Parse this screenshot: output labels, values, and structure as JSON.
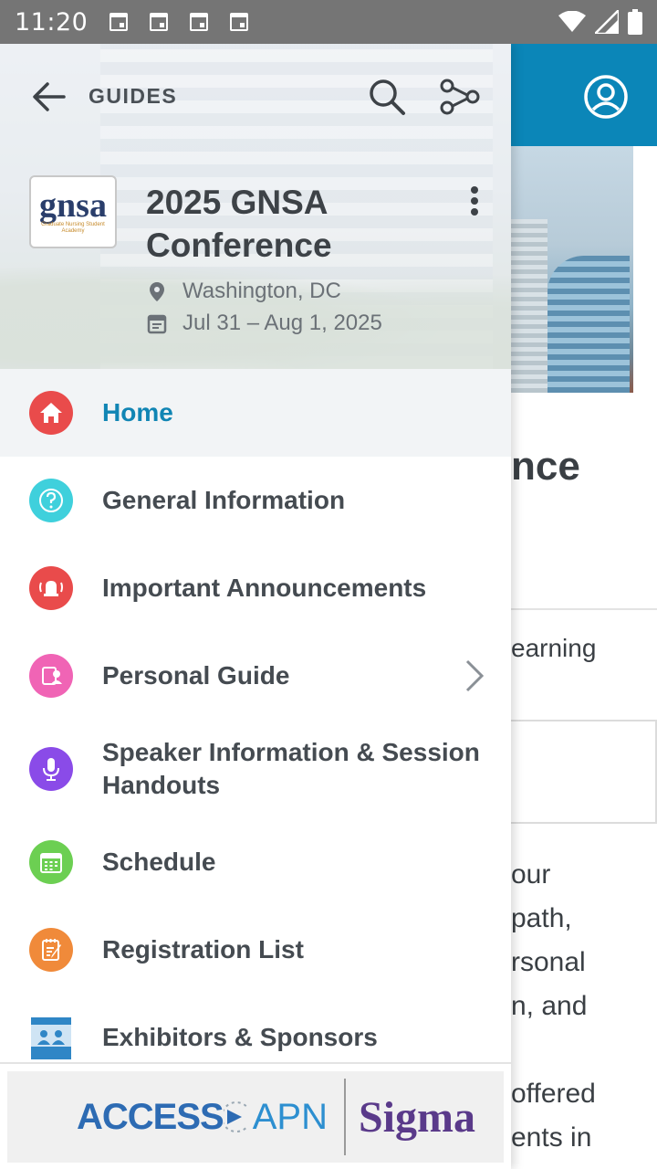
{
  "status_bar": {
    "time": "11:20"
  },
  "drawer": {
    "header": {
      "back_label": "GUIDES",
      "logo_text": "gnsa",
      "logo_subtext": "Graduate Nursing Student Academy",
      "title": "2025 GNSA Conference",
      "location": "Washington, DC",
      "dates": "Jul 31 – Aug 1, 2025"
    },
    "menu": [
      {
        "label": "Home",
        "icon": "home-icon",
        "color": "#e94b4b",
        "active": true
      },
      {
        "label": "General Information",
        "icon": "question-icon",
        "color": "#3fd0dc"
      },
      {
        "label": "Important Announcements",
        "icon": "bell-icon",
        "color": "#e94b4b"
      },
      {
        "label": "Personal Guide",
        "icon": "personal-guide-icon",
        "color": "#f064b5",
        "has_submenu": true
      },
      {
        "label": "Speaker Information & Session Handouts",
        "icon": "microphone-icon",
        "color": "#8a4be8"
      },
      {
        "label": "Schedule",
        "icon": "calendar-icon",
        "color": "#6ccf52"
      },
      {
        "label": "Registration List",
        "icon": "clipboard-icon",
        "color": "#f08a3a"
      },
      {
        "label": "Exhibitors & Sponsors",
        "icon": "booth-icon",
        "color": "#2f86c6"
      }
    ],
    "ad": {
      "left_text": "ACCESS",
      "middle_text": "APN",
      "right_text": "Sigma"
    }
  },
  "background": {
    "title_fragment": "nce",
    "subtitle_fragment": "earning",
    "paragraph_lines": [
      "our",
      "path,",
      "rsonal",
      "n, and",
      "",
      "offered",
      "ents in"
    ]
  },
  "colors": {
    "accent": "#1185b4",
    "header_blue": "#0b86b8"
  }
}
